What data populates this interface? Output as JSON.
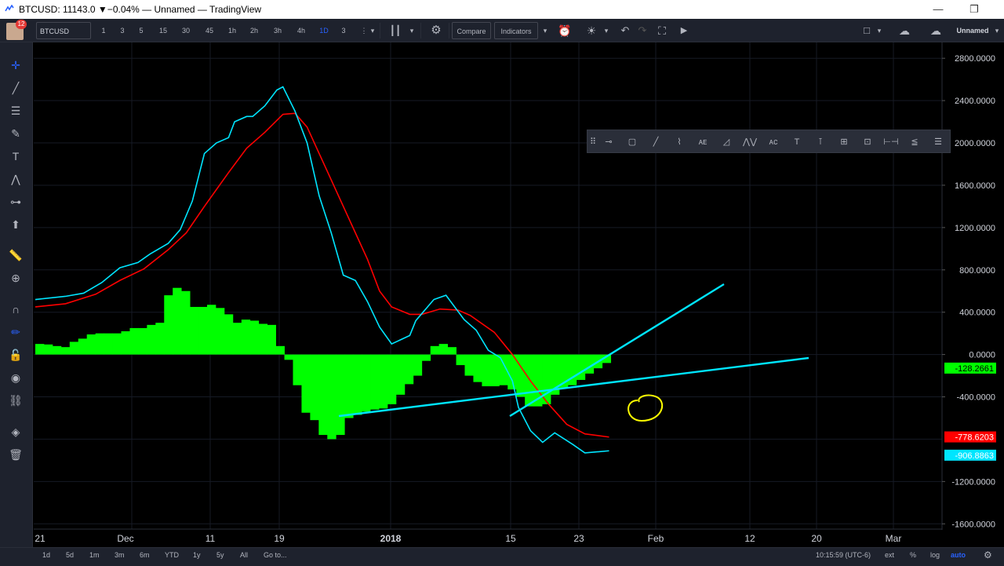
{
  "window": {
    "title": "BTCUSD: 11143.0 ▼−0.04% — Unnamed — TradingView",
    "minimize": "—",
    "restore": "❐"
  },
  "toolbar": {
    "avatar_badge": "12",
    "symbol": "BTCUSD",
    "intervals": [
      "1",
      "3",
      "5",
      "15",
      "30",
      "45",
      "1h",
      "2h",
      "3h",
      "4h",
      "1D",
      "3"
    ],
    "compare": "Compare",
    "indicators": "Indicators",
    "layout_name": "Unnamed"
  },
  "price_axis": {
    "ticks": [
      "2800.0000",
      "2400.0000",
      "2000.0000",
      "1600.0000",
      "1200.0000",
      "800.0000",
      "400.0000",
      "0.0000",
      "-400.0000",
      "-1200.0000",
      "-1600.0000"
    ],
    "labels": [
      {
        "text": "-128.2661",
        "color": "#00ff00"
      },
      {
        "text": "-778.6203",
        "color": "#ff0000"
      },
      {
        "text": "-906.8863",
        "color": "#00e5ff"
      }
    ]
  },
  "time_axis": {
    "ticks": [
      "21",
      "Dec",
      "11",
      "19",
      "2018",
      "15",
      "23",
      "Feb",
      "12",
      "20",
      "Mar"
    ]
  },
  "bottom": {
    "ranges": [
      "1d",
      "5d",
      "1m",
      "3m",
      "6m",
      "YTD",
      "1y",
      "5y",
      "All"
    ],
    "goto": "Go to...",
    "clock": "10:15:59 (UTC-6)",
    "ext": "ext",
    "pct": "%",
    "log": "log",
    "auto": "auto"
  },
  "colors": {
    "macd_line": "#00e5ff",
    "signal_line": "#ff0000",
    "histogram": "#00ff00",
    "trendline": "#00e5ff",
    "annotation": "#ffff00",
    "accent": "#2962ff"
  },
  "chart_data": {
    "type": "line",
    "y_unit": "MACD value",
    "ylim": [
      -1650,
      2950
    ],
    "grid": true,
    "series": [
      {
        "points": [
          [
            0,
            520
          ],
          [
            5,
            550
          ],
          [
            8,
            580
          ],
          [
            11,
            680
          ],
          [
            14,
            820
          ],
          [
            17,
            870
          ],
          [
            19,
            950
          ],
          [
            22,
            1050
          ],
          [
            24,
            1180
          ],
          [
            26,
            1450
          ],
          [
            28,
            1900
          ],
          [
            30,
            2000
          ],
          [
            32,
            2050
          ],
          [
            33,
            2200
          ],
          [
            35,
            2250
          ],
          [
            36,
            2250
          ],
          [
            38,
            2350
          ],
          [
            40,
            2500
          ],
          [
            41,
            2530
          ],
          [
            43,
            2300
          ],
          [
            45,
            2000
          ],
          [
            47,
            1500
          ],
          [
            49,
            1150
          ],
          [
            51,
            750
          ],
          [
            53,
            700
          ],
          [
            55,
            500
          ],
          [
            57,
            260
          ],
          [
            59,
            100
          ],
          [
            62,
            180
          ],
          [
            63,
            320
          ],
          [
            66,
            520
          ],
          [
            68,
            560
          ],
          [
            71,
            330
          ],
          [
            73,
            230
          ],
          [
            75,
            40
          ],
          [
            77,
            -30
          ],
          [
            79,
            -250
          ],
          [
            80,
            -500
          ],
          [
            82,
            -720
          ],
          [
            84,
            -830
          ],
          [
            86,
            -740
          ],
          [
            89,
            -850
          ],
          [
            91,
            -930
          ],
          [
            93,
            -920
          ],
          [
            95,
            -910
          ]
        ]
      },
      {
        "points": [
          [
            0,
            450
          ],
          [
            5,
            480
          ],
          [
            10,
            570
          ],
          [
            14,
            700
          ],
          [
            18,
            810
          ],
          [
            22,
            990
          ],
          [
            25,
            1150
          ],
          [
            28,
            1400
          ],
          [
            32,
            1720
          ],
          [
            35,
            1950
          ],
          [
            38,
            2100
          ],
          [
            41,
            2270
          ],
          [
            43,
            2280
          ],
          [
            45,
            2150
          ],
          [
            47,
            1900
          ],
          [
            49,
            1650
          ],
          [
            51,
            1400
          ],
          [
            53,
            1150
          ],
          [
            55,
            900
          ],
          [
            57,
            600
          ],
          [
            59,
            450
          ],
          [
            62,
            380
          ],
          [
            64,
            380
          ],
          [
            67,
            430
          ],
          [
            70,
            420
          ],
          [
            72,
            370
          ],
          [
            76,
            210
          ],
          [
            79,
            0
          ],
          [
            82,
            -250
          ],
          [
            85,
            -470
          ],
          [
            88,
            -660
          ],
          [
            91,
            -750
          ],
          [
            95,
            -780
          ]
        ]
      }
    ],
    "histogram": [
      100,
      95,
      80,
      70,
      120,
      150,
      190,
      200,
      200,
      200,
      220,
      250,
      250,
      280,
      300,
      560,
      630,
      600,
      450,
      450,
      470,
      440,
      380,
      300,
      330,
      320,
      290,
      280,
      80,
      -50,
      -290,
      -550,
      -620,
      -760,
      -800,
      -760,
      -600,
      -570,
      -540,
      -520,
      -510,
      -470,
      -380,
      -280,
      -200,
      -60,
      80,
      100,
      70,
      -100,
      -200,
      -260,
      -300,
      -300,
      -290,
      -330,
      -400,
      -490,
      -490,
      -470,
      -380,
      -320,
      -290,
      -240,
      -180,
      -130,
      -80
    ]
  }
}
